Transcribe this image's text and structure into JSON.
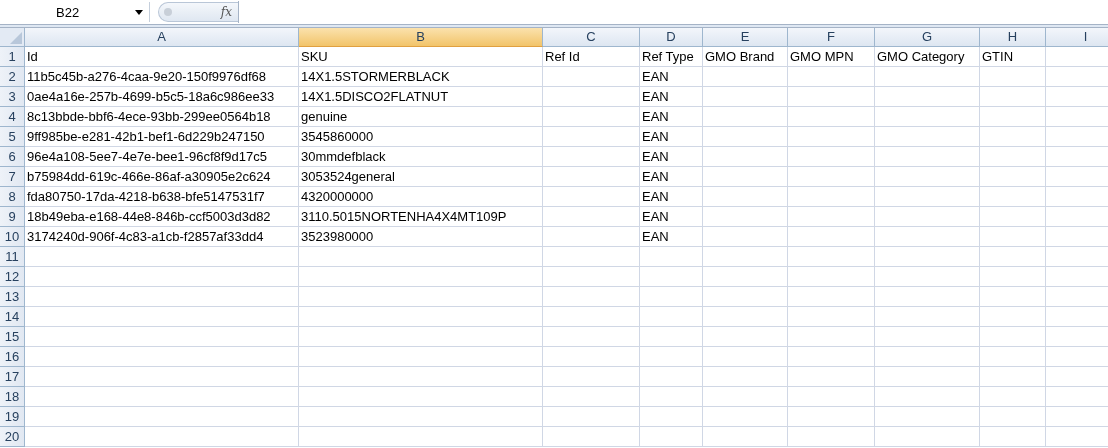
{
  "formula_bar": {
    "name_box": "B22",
    "function_label": "fx"
  },
  "columns": [
    {
      "letter": "A",
      "selected": false
    },
    {
      "letter": "B",
      "selected": true
    },
    {
      "letter": "C",
      "selected": false
    },
    {
      "letter": "D",
      "selected": false
    },
    {
      "letter": "E",
      "selected": false
    },
    {
      "letter": "F",
      "selected": false
    },
    {
      "letter": "G",
      "selected": false
    },
    {
      "letter": "H",
      "selected": false
    },
    {
      "letter": "I",
      "selected": false
    }
  ],
  "rows": [
    {
      "number": "1",
      "A": "Id",
      "B": "SKU",
      "C": "Ref Id",
      "D": "Ref Type",
      "E": "GMO Brand",
      "F": "GMO MPN",
      "G": "GMO Category",
      "H": "GTIN"
    },
    {
      "number": "2",
      "A": "11b5c45b-a276-4caa-9e20-150f9976df68",
      "B": "14X1.5STORMERBLACK",
      "D": "EAN"
    },
    {
      "number": "3",
      "A": "0ae4a16e-257b-4699-b5c5-18a6c986ee33",
      "B": "14X1.5DISCO2FLATNUT",
      "D": "EAN"
    },
    {
      "number": "4",
      "A": "8c13bbde-bbf6-4ece-93bb-299ee0564b18",
      "B": "genuine",
      "D": "EAN"
    },
    {
      "number": "5",
      "A": "9ff985be-e281-42b1-bef1-6d229b247150",
      "B": "3545860000",
      "D": "EAN"
    },
    {
      "number": "6",
      "A": "96e4a108-5ee7-4e7e-bee1-96cf8f9d17c5",
      "B": "30mmdefblack",
      "D": "EAN"
    },
    {
      "number": "7",
      "A": "b75984dd-619c-466e-86af-a30905e2c624",
      "B": "3053524general",
      "D": "EAN"
    },
    {
      "number": "8",
      "A": "fda80750-17da-4218-b638-bfe5147531f7",
      "B": "4320000000",
      "D": "EAN"
    },
    {
      "number": "9",
      "A": "18b49eba-e168-44e8-846b-ccf5003d3d82",
      "B": "3110.5015NORTENHA4X4MT109P",
      "D": "EAN"
    },
    {
      "number": "10",
      "A": "3174240d-906f-4c83-a1cb-f2857af33dd4",
      "B": "3523980000",
      "D": "EAN"
    },
    {
      "number": "11"
    },
    {
      "number": "12"
    },
    {
      "number": "13"
    },
    {
      "number": "14"
    },
    {
      "number": "15"
    },
    {
      "number": "16"
    },
    {
      "number": "17"
    },
    {
      "number": "18"
    },
    {
      "number": "19"
    },
    {
      "number": "20"
    }
  ]
}
